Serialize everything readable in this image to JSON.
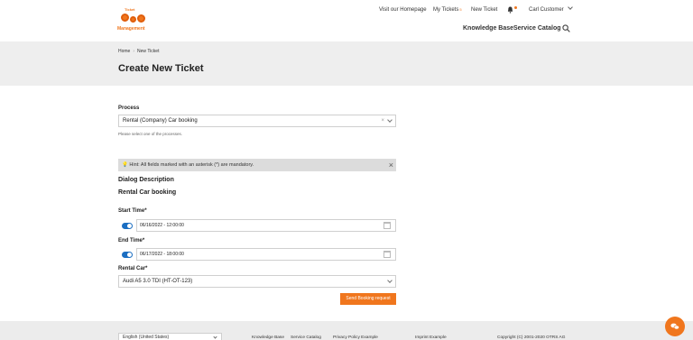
{
  "header": {
    "logo_top": "Ticket",
    "logo_text": "Management",
    "top_links": {
      "homepage": "Visit our Homepage",
      "my_tickets": "My Tickets",
      "my_tickets_badge": "5",
      "new_ticket": "New Ticket",
      "user": "Carl Customer"
    },
    "main_nav": {
      "knowledge_base": "Knowledge Base",
      "service_catalog": "Service Catalog"
    }
  },
  "breadcrumb": {
    "home": "Home",
    "current": "New Ticket"
  },
  "page_title": "Create New Ticket",
  "form": {
    "process_label": "Process",
    "process_value": "Rental (Company) Car booking",
    "process_help": "Please select one of the processes.",
    "hint": "Hint: All fields marked with an asterisk (*) are mandatory.",
    "dialog_description": "Dialog Description",
    "dialog_name": "Rental Car booking",
    "start_label": "Start Time*",
    "start_value": "06/16/2022 - 12:00:00",
    "end_label": "End Time*",
    "end_value": "06/17/2022 - 18:00:00",
    "car_label": "Rental Car*",
    "car_value": "Audi A5 3.0 TDI (HT-OT-123)",
    "send_label": "Send Booking request"
  },
  "footer": {
    "language": "English (United States)",
    "links": [
      "Knowledge Base",
      "Service Catalog",
      "Privacy Policy Example",
      "Imprint Example"
    ],
    "copyright": "Copyright (C) 2001-2020 OTRS AG"
  },
  "colors": {
    "accent": "#f0761d",
    "toggle": "#1b6ec2",
    "band": "#eeeeee"
  }
}
